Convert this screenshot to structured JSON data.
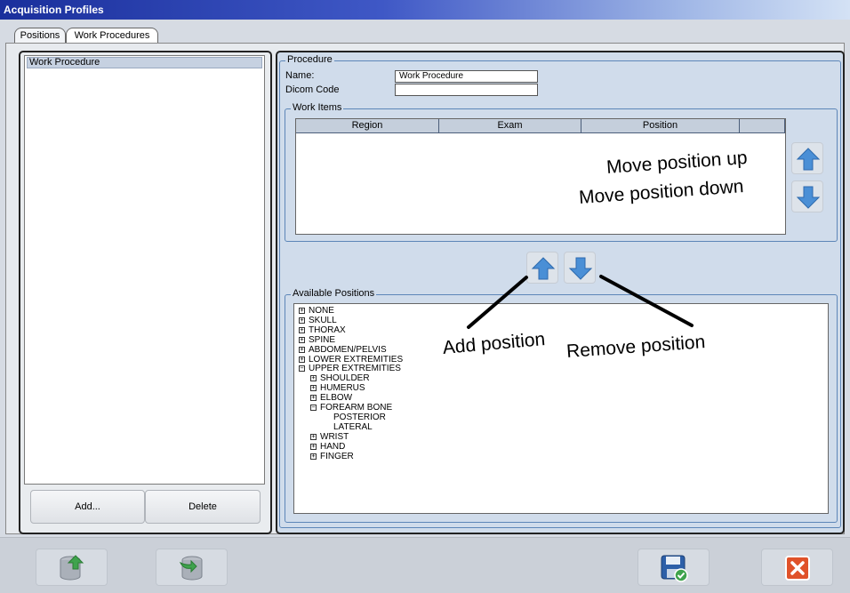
{
  "window": {
    "title": "Acquisition Profiles"
  },
  "tabs": [
    {
      "label": "Positions",
      "active": false
    },
    {
      "label": "Work Procedures",
      "active": true
    }
  ],
  "procedures_list": {
    "items": [
      "Work Procedure"
    ],
    "selected": "Work Procedure"
  },
  "left_buttons": {
    "add_label": "Add...",
    "delete_label": "Delete"
  },
  "procedure": {
    "group_label": "Procedure",
    "name_label": "Name:",
    "name_value": "Work Procedure",
    "dicom_label": "Dicom Code",
    "dicom_value": ""
  },
  "work_items": {
    "group_label": "Work Items",
    "columns": [
      "Region",
      "Exam",
      "Position",
      ""
    ]
  },
  "available_positions": {
    "group_label": "Available Positions",
    "tree": [
      {
        "label": "NONE",
        "toggle": "+",
        "level": 0
      },
      {
        "label": "SKULL",
        "toggle": "+",
        "level": 0
      },
      {
        "label": "THORAX",
        "toggle": "+",
        "level": 0
      },
      {
        "label": "SPINE",
        "toggle": "+",
        "level": 0
      },
      {
        "label": "ABDOMEN/PELVIS",
        "toggle": "+",
        "level": 0
      },
      {
        "label": "LOWER EXTREMITIES",
        "toggle": "+",
        "level": 0
      },
      {
        "label": "UPPER EXTREMITIES",
        "toggle": "-",
        "level": 0
      },
      {
        "label": "SHOULDER",
        "toggle": "+",
        "level": 1
      },
      {
        "label": "HUMERUS",
        "toggle": "+",
        "level": 1
      },
      {
        "label": "ELBOW",
        "toggle": "+",
        "level": 1
      },
      {
        "label": "FOREARM BONE",
        "toggle": "-",
        "level": 1
      },
      {
        "label": "POSTERIOR",
        "toggle": "",
        "level": 2
      },
      {
        "label": "LATERAL",
        "toggle": "",
        "level": 2
      },
      {
        "label": "WRIST",
        "toggle": "+",
        "level": 1
      },
      {
        "label": "HAND",
        "toggle": "+",
        "level": 1
      },
      {
        "label": "FINGER",
        "toggle": "+",
        "level": 1
      }
    ]
  },
  "annotations": {
    "move_up": "Move position up",
    "move_down": "Move position down",
    "add": "Add position",
    "remove": "Remove position"
  },
  "icons": {
    "move_up": "arrow-up-icon",
    "move_down": "arrow-down-icon",
    "add": "arrow-up-icon",
    "remove": "arrow-down-icon",
    "import": "database-import-icon",
    "export": "database-export-icon",
    "save": "save-icon",
    "close": "close-icon"
  },
  "colors": {
    "accent_blue": "#4a8fd6",
    "title_gradient_start": "#1a2f9c",
    "close_red": "#e0522a",
    "save_blue": "#2d5fa8",
    "panel_bg": "#d0dceb"
  }
}
